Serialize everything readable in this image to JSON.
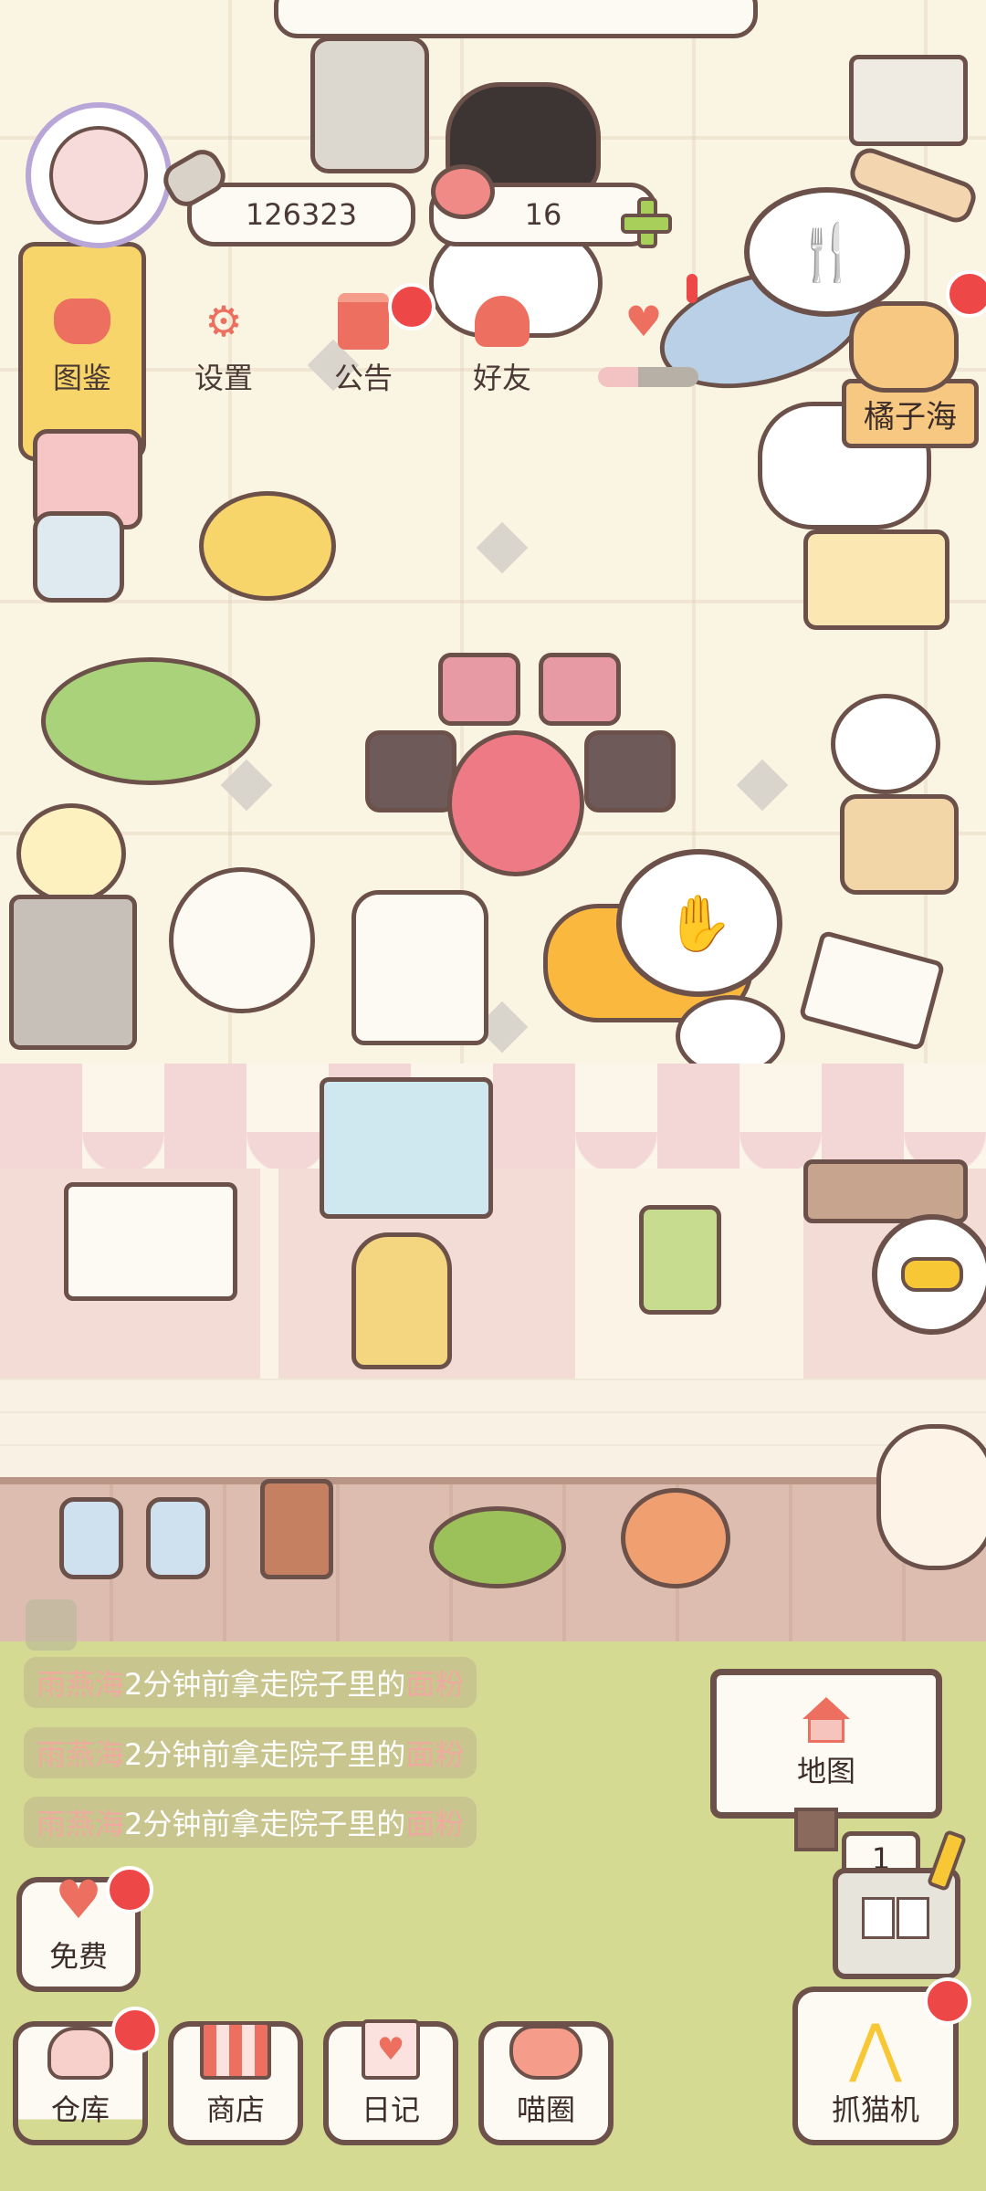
{
  "hud": {
    "currency_fish": "126323",
    "currency_cat": "16"
  },
  "menu": [
    {
      "label": "图鉴",
      "icon": "cat-head-icon"
    },
    {
      "label": "设置",
      "icon": "gear-icon"
    },
    {
      "label": "公告",
      "icon": "gift-icon"
    },
    {
      "label": "好友",
      "icon": "friends-icon"
    },
    {
      "label": "",
      "icon": "heart-mail-icon"
    }
  ],
  "scene": {
    "cat_name_tag": "橘子海"
  },
  "feed": [
    {
      "name": "雨燕海",
      "text": "2分钟前拿走院子里的",
      "item": "面粉"
    },
    {
      "name": "雨燕海",
      "text": "2分钟前拿走院子里的",
      "item": "面粉"
    },
    {
      "name": "雨燕海",
      "text": "2分钟前拿走院子里的",
      "item": "面粉"
    }
  ],
  "map_button": "地图",
  "slot_counter": "1",
  "buttons": {
    "free": "免费",
    "warehouse": "仓库",
    "shop": "商店",
    "diary": "日记",
    "circle": "喵圈",
    "claw": "抓猫机"
  },
  "colors": {
    "accent": "#ec6f5f",
    "badge": "#ee4747",
    "outline": "#6b5149",
    "grass": "#d5da93"
  }
}
